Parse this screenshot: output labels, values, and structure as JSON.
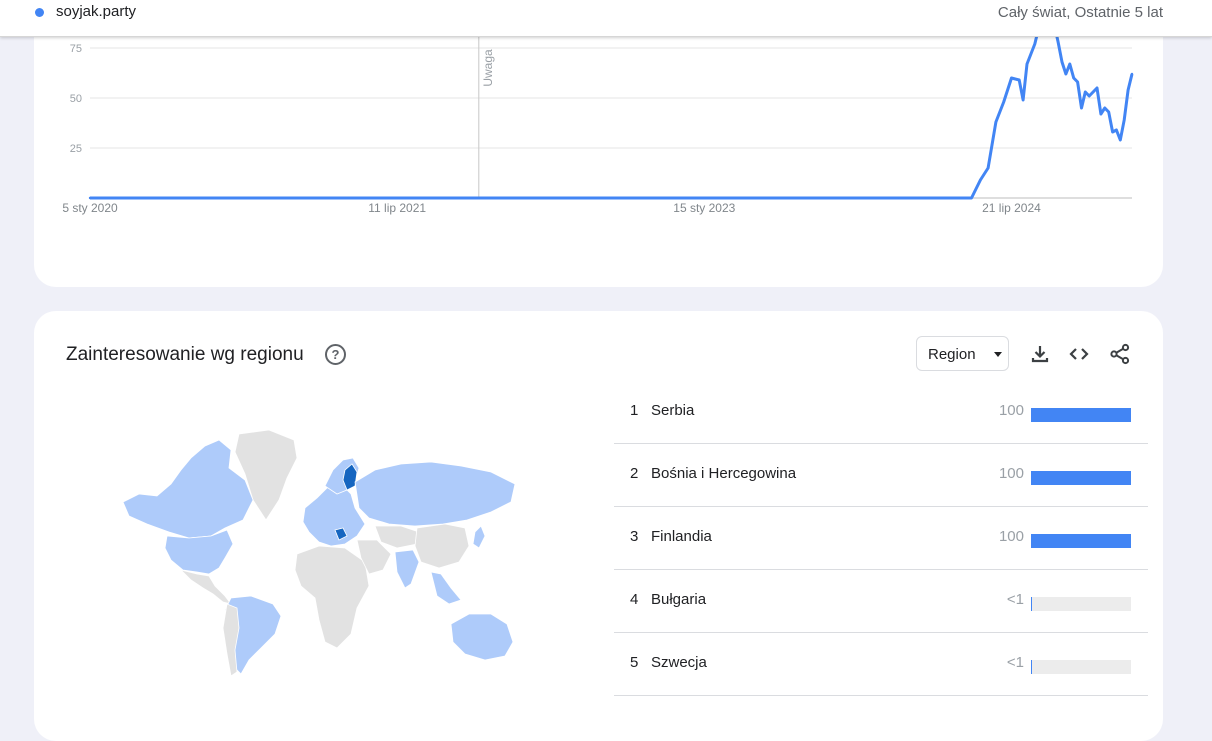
{
  "header": {
    "term": "soyjak.party",
    "term_color": "#4285f4",
    "scope": "Cały świat, Ostatnie 5 lat"
  },
  "chart_data": {
    "type": "line",
    "series": [
      {
        "name": "soyjak.party",
        "color": "#4285f4",
        "points": [
          [
            "2020-01-05",
            0
          ],
          [
            "2021-01-01",
            0
          ],
          [
            "2022-01-01",
            0
          ],
          [
            "2023-01-01",
            0
          ],
          [
            "2024-01-01",
            0
          ],
          [
            "2024-05-10",
            0
          ],
          [
            "2024-05-26",
            9
          ],
          [
            "2024-06-09",
            15
          ],
          [
            "2024-06-23",
            38
          ],
          [
            "2024-07-07",
            48
          ],
          [
            "2024-07-21",
            60
          ],
          [
            "2024-08-04",
            59
          ],
          [
            "2024-08-11",
            49
          ],
          [
            "2024-08-18",
            67
          ],
          [
            "2024-09-01",
            77
          ],
          [
            "2024-09-08",
            85
          ],
          [
            "2024-09-15",
            92
          ],
          [
            "2024-09-22",
            88
          ],
          [
            "2024-09-29",
            93
          ],
          [
            "2024-10-06",
            87
          ],
          [
            "2024-10-13",
            78
          ],
          [
            "2024-10-20",
            68
          ],
          [
            "2024-10-27",
            62
          ],
          [
            "2024-11-03",
            67
          ],
          [
            "2024-11-10",
            60
          ],
          [
            "2024-11-17",
            58
          ],
          [
            "2024-11-24",
            45
          ],
          [
            "2024-12-01",
            53
          ],
          [
            "2024-12-08",
            51
          ],
          [
            "2024-12-15",
            53
          ],
          [
            "2024-12-22",
            55
          ],
          [
            "2024-12-29",
            42
          ],
          [
            "2025-01-05",
            45
          ],
          [
            "2025-01-12",
            43
          ],
          [
            "2025-01-19",
            33
          ],
          [
            "2025-01-26",
            34
          ],
          [
            "2025-02-02",
            29
          ],
          [
            "2025-02-09",
            39
          ],
          [
            "2025-02-16",
            54
          ],
          [
            "2025-02-23",
            62
          ]
        ]
      }
    ],
    "x_ticks": [
      "5 sty 2020",
      "11 lip 2021",
      "15 sty 2023",
      "21 lip 2024"
    ],
    "x_tick_dates": [
      "2020-01-05",
      "2021-07-11",
      "2023-01-15",
      "2024-07-21"
    ],
    "x_range": [
      "2020-01-05",
      "2025-02-23"
    ],
    "y_ticks": [
      25,
      50,
      75
    ],
    "ylim": [
      0,
      100
    ],
    "annotations": [
      {
        "date": "2021-12-05",
        "label": "Uwaga"
      }
    ],
    "grid": true
  },
  "region_section": {
    "title": "Zainteresowanie wg regionu",
    "help_icon": "help-circle-icon",
    "select_value": "Region",
    "icons": [
      "download-icon",
      "embed-code-icon",
      "share-icon"
    ],
    "rows": [
      {
        "rank": "1",
        "name": "Serbia",
        "value_label": "100",
        "value": 100
      },
      {
        "rank": "2",
        "name": "Bośnia i Hercegowina",
        "value_label": "100",
        "value": 100
      },
      {
        "rank": "3",
        "name": "Finlandia",
        "value_label": "100",
        "value": 100
      },
      {
        "rank": "4",
        "name": "Bułgaria",
        "value_label": "<1",
        "value": 0.5
      },
      {
        "rank": "5",
        "name": "Szwecja",
        "value_label": "<1",
        "value": 0.5
      }
    ],
    "map_colors": {
      "high": "#1565c0",
      "low": "#aecbfa",
      "none": "#e2e2e2"
    }
  }
}
